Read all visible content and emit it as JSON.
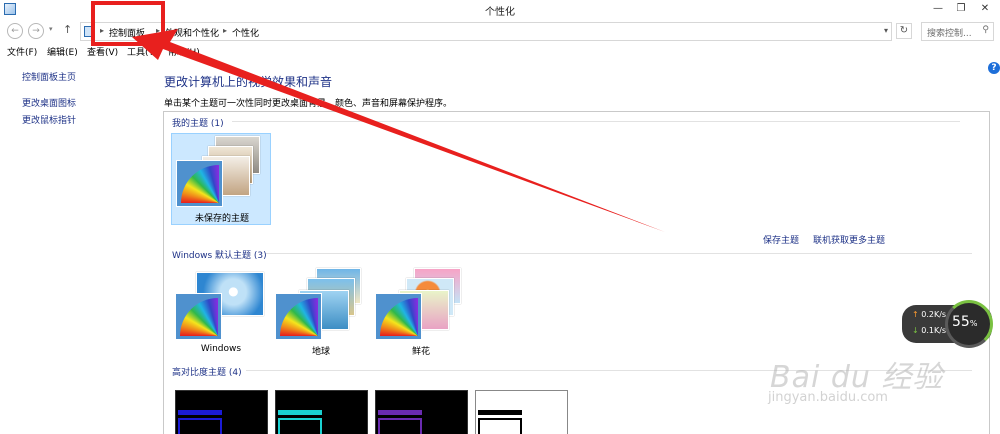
{
  "window": {
    "title": "个性化"
  },
  "address": {
    "crumbs": [
      "控制面板",
      "外观和个性化",
      "个性化"
    ]
  },
  "search": {
    "placeholder": "搜索控制..."
  },
  "menu": [
    "文件(F)",
    "编辑(E)",
    "查看(V)",
    "工具(T)",
    "帮助(H)"
  ],
  "leftnav": [
    "控制面板主页",
    "更改桌面图标",
    "更改鼠标指针"
  ],
  "main": {
    "title": "更改计算机上的视觉效果和声音",
    "description": "单击某个主题可一次性同时更改桌面背景、颜色、声音和屏幕保护程序。"
  },
  "sections": {
    "my": {
      "heading": "我的主题 (1)",
      "themes": [
        "未保存的主题"
      ]
    },
    "links": {
      "save": "保存主题",
      "online": "联机获取更多主题"
    },
    "windows": {
      "heading": "Windows 默认主题 (3)",
      "themes": [
        "Windows",
        "地球",
        "鲜花"
      ]
    },
    "hc": {
      "heading": "高对比度主题 (4)"
    }
  },
  "net": {
    "up": "0.2K/s",
    "down": "0.1K/s",
    "pct": "55",
    "pct_unit": "%"
  },
  "watermark": {
    "brand": "Bai du 经验",
    "url": "jingyan.baidu.com"
  },
  "colors": {
    "link": "#1e3287",
    "selection": "#cce8ff",
    "annotation": "#e8201e"
  }
}
